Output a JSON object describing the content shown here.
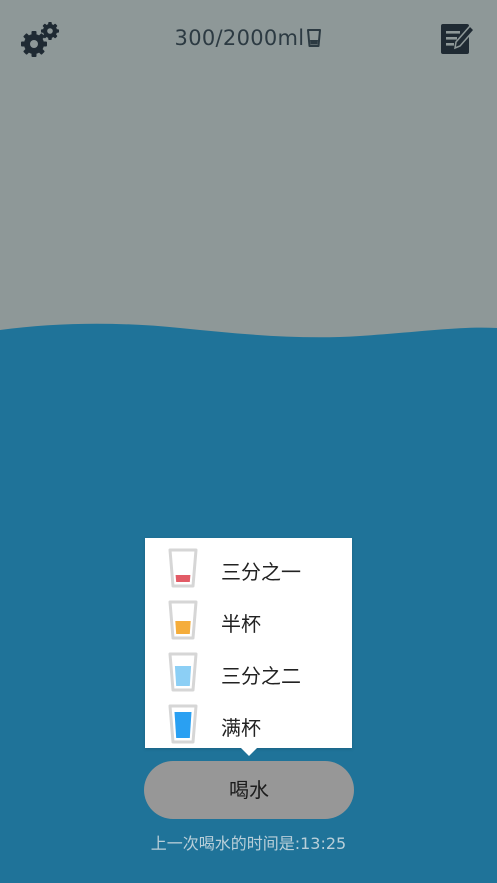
{
  "header": {
    "progress_text": "300/2000ml",
    "icons": {
      "settings": "gears-icon",
      "log": "edit-list-icon",
      "progress_cup": "cup-icon"
    }
  },
  "colors": {
    "sky": "#8e9898",
    "water": "#1f7399",
    "icon_dark": "#1f2a33",
    "third_fill": "#e25b66",
    "half_fill": "#f5ad3b",
    "two_thirds_fill": "#8ccff5",
    "full_fill": "#2aa0f2",
    "button": "#979797"
  },
  "popup": {
    "options": [
      {
        "label": "三分之一",
        "fill_fraction": 0.33,
        "color": "#e25b66"
      },
      {
        "label": "半杯",
        "fill_fraction": 0.5,
        "color": "#f5ad3b"
      },
      {
        "label": "三分之二",
        "fill_fraction": 0.67,
        "color": "#8ccff5"
      },
      {
        "label": "满杯",
        "fill_fraction": 1.0,
        "color": "#2aa0f2"
      }
    ]
  },
  "drink_button": {
    "label": "喝水"
  },
  "last_drink": {
    "text": "上一次喝水的时间是:13:25"
  }
}
